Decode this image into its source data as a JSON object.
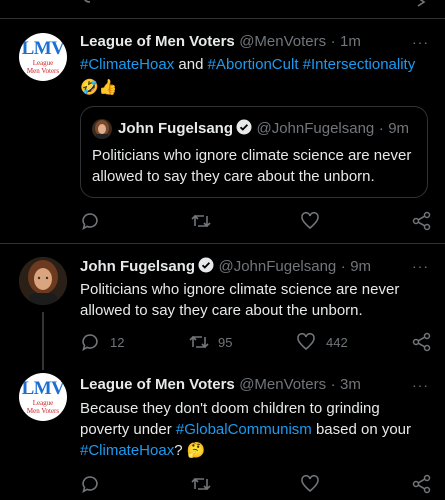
{
  "tweet1": {
    "name": "League of Men Voters",
    "handle": "@MenVoters",
    "dot": "·",
    "time": "1m",
    "more": "···",
    "tag1": "#ClimateHoax",
    "and": " and ",
    "tag2": "#AbortionCult",
    "tag3": "#Intersectionality",
    "emoji": "🤣👍",
    "quote": {
      "name": "John Fugelsang",
      "handle": "@JohnFugelsang",
      "dot": "·",
      "time": "9m",
      "line1": "Politicians who ignore climate science are never",
      "line2": "allowed to say they care about the unborn."
    }
  },
  "tweet2": {
    "name": "John Fugelsang",
    "handle": "@JohnFugelsang",
    "dot": "·",
    "time": "9m",
    "more": "···",
    "line1": "Politicians who ignore climate science are never",
    "line2": "allowed to say they care about the unborn.",
    "replies": "12",
    "retweets": "95",
    "likes": "442"
  },
  "tweet3": {
    "name": "League of Men Voters",
    "handle": "@MenVoters",
    "dot": "·",
    "time": "3m",
    "more": "···",
    "line1": "Because they don't doom children to grinding",
    "line2a": "poverty under ",
    "tag1": "#GlobalCommunism",
    "line2b": " based on your",
    "tag2": "#ClimateHoax",
    "line3b": "? ",
    "emoji": "🤔"
  },
  "avatar": {
    "big": "LMV",
    "sm1": "League",
    "sm2": "Men Voters"
  }
}
